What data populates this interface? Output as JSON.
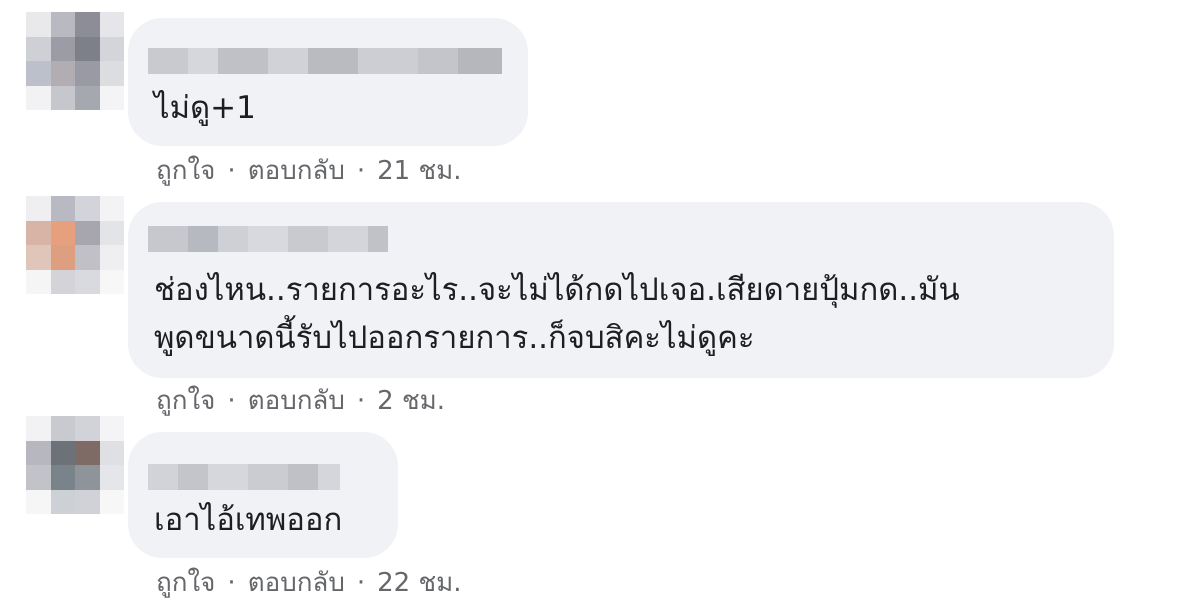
{
  "comments": [
    {
      "text": "ไม่ดู+1",
      "like_label": "ถูกใจ",
      "reply_label": "ตอบกลับ",
      "separator": "·",
      "time": "21 ชม."
    },
    {
      "text": "ช่องไหน..รายการอะไร..จะไม่ได้กดไปเจอ.เสียดายปุ้มกด..มัน\nพูดขนาดนี้รับไปออกรายการ..ก็จบสิคะไม่ดูคะ",
      "like_label": "ถูกใจ",
      "reply_label": "ตอบกลับ",
      "separator": "·",
      "time": "2 ชม."
    },
    {
      "text": "เอาไอ้เทพออก",
      "like_label": "ถูกใจ",
      "reply_label": "ตอบกลับ",
      "separator": "·",
      "time": "22 ชม."
    }
  ]
}
